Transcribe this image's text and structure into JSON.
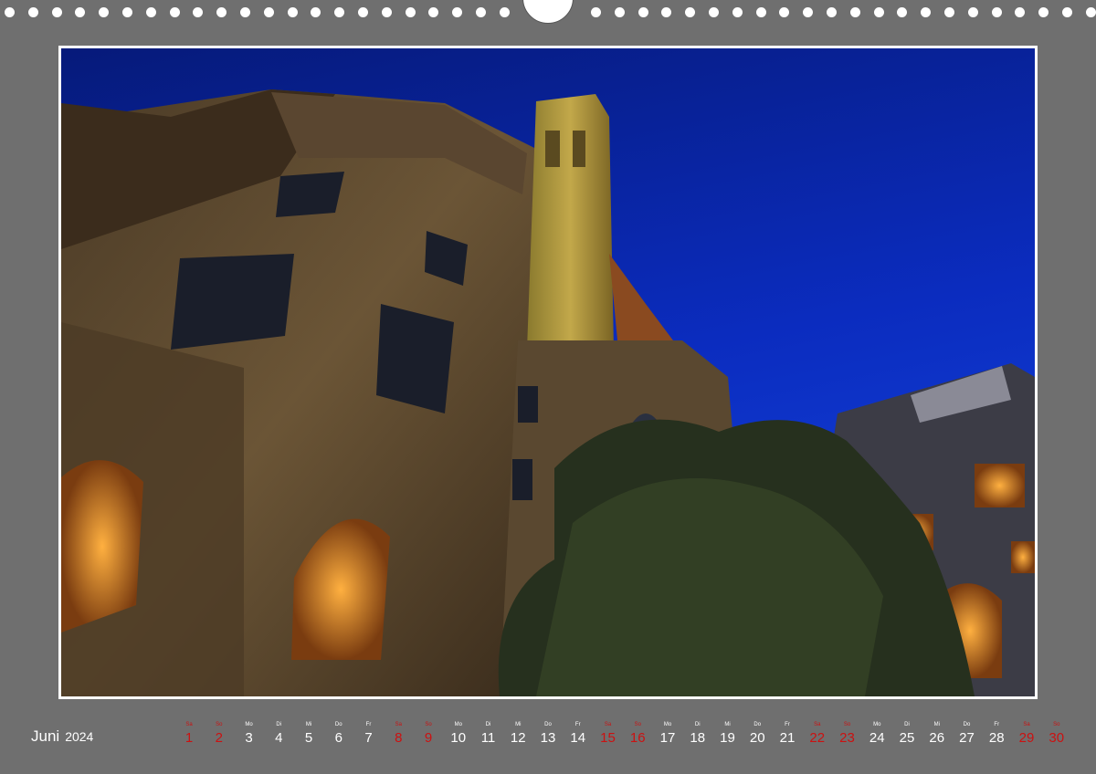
{
  "calendar": {
    "month": "Juni",
    "year": "2024",
    "weekend_color": "#cc1111",
    "days": [
      {
        "dow": "Sa",
        "num": "1",
        "weekend": true
      },
      {
        "dow": "So",
        "num": "2",
        "weekend": true
      },
      {
        "dow": "Mo",
        "num": "3",
        "weekend": false
      },
      {
        "dow": "Di",
        "num": "4",
        "weekend": false
      },
      {
        "dow": "Mi",
        "num": "5",
        "weekend": false
      },
      {
        "dow": "Do",
        "num": "6",
        "weekend": false
      },
      {
        "dow": "Fr",
        "num": "7",
        "weekend": false
      },
      {
        "dow": "Sa",
        "num": "8",
        "weekend": true
      },
      {
        "dow": "So",
        "num": "9",
        "weekend": true
      },
      {
        "dow": "Mo",
        "num": "10",
        "weekend": false
      },
      {
        "dow": "Di",
        "num": "11",
        "weekend": false
      },
      {
        "dow": "Mi",
        "num": "12",
        "weekend": false
      },
      {
        "dow": "Do",
        "num": "13",
        "weekend": false
      },
      {
        "dow": "Fr",
        "num": "14",
        "weekend": false
      },
      {
        "dow": "Sa",
        "num": "15",
        "weekend": true
      },
      {
        "dow": "So",
        "num": "16",
        "weekend": true
      },
      {
        "dow": "Mo",
        "num": "17",
        "weekend": false
      },
      {
        "dow": "Di",
        "num": "18",
        "weekend": false
      },
      {
        "dow": "Mi",
        "num": "19",
        "weekend": false
      },
      {
        "dow": "Do",
        "num": "20",
        "weekend": false
      },
      {
        "dow": "Fr",
        "num": "21",
        "weekend": false
      },
      {
        "dow": "Sa",
        "num": "22",
        "weekend": true
      },
      {
        "dow": "So",
        "num": "23",
        "weekend": true
      },
      {
        "dow": "Mo",
        "num": "24",
        "weekend": false
      },
      {
        "dow": "Di",
        "num": "25",
        "weekend": false
      },
      {
        "dow": "Mi",
        "num": "26",
        "weekend": false
      },
      {
        "dow": "Do",
        "num": "27",
        "weekend": false
      },
      {
        "dow": "Fr",
        "num": "28",
        "weekend": false
      },
      {
        "dow": "Sa",
        "num": "29",
        "weekend": true
      },
      {
        "dow": "So",
        "num": "30",
        "weekend": true
      }
    ]
  }
}
